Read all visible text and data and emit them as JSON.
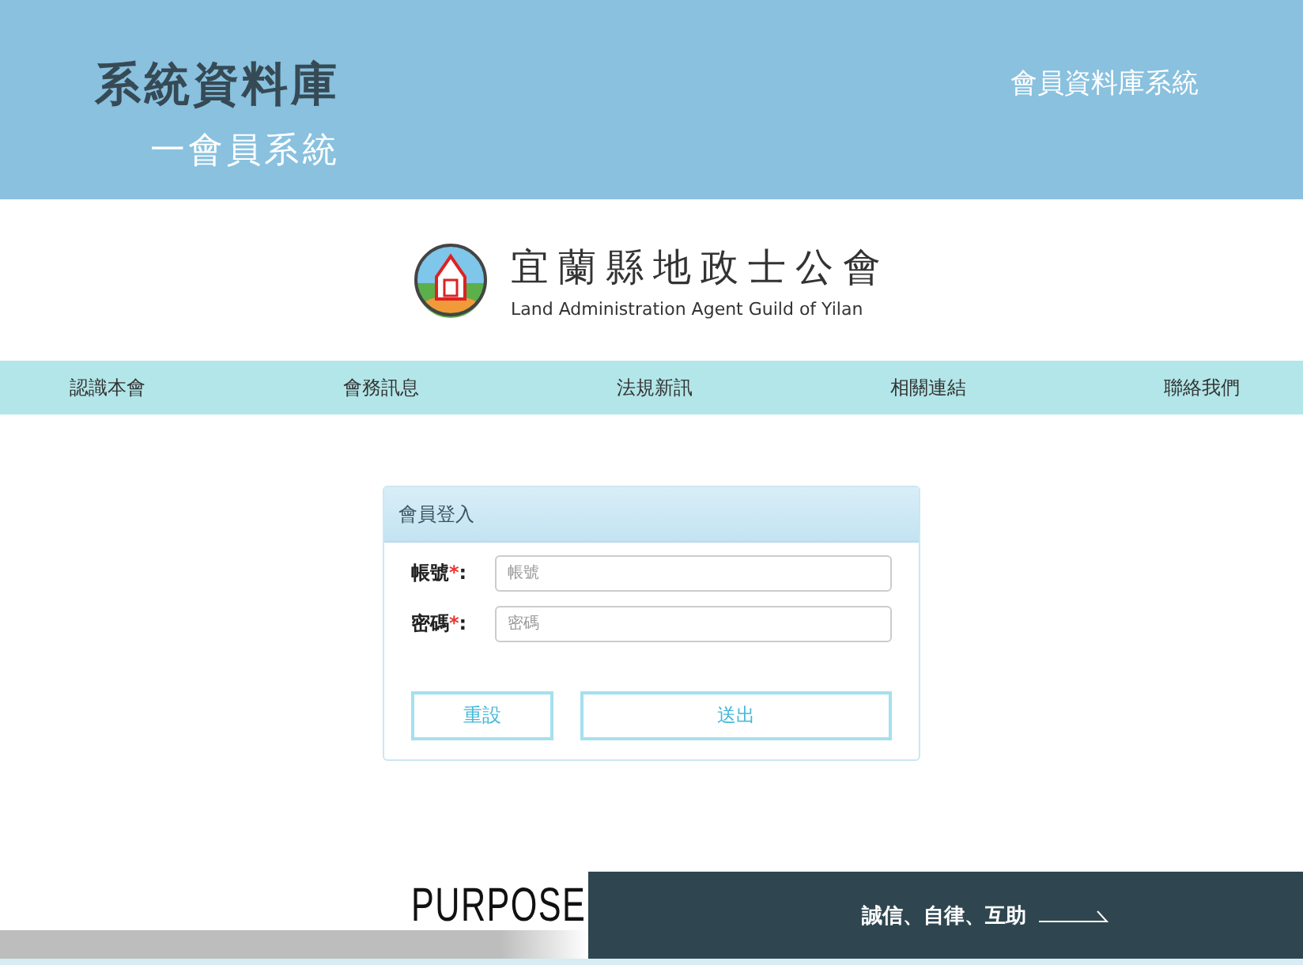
{
  "header": {
    "title": "系統資料庫",
    "subtitle": "一會員系統",
    "system_name": "會員資料庫系統"
  },
  "logo": {
    "name": "宜蘭縣地政士公會",
    "english": "Land Administration Agent Guild of Yilan"
  },
  "nav": [
    {
      "label": "認識本會"
    },
    {
      "label": "會務訊息"
    },
    {
      "label": "法規新訊"
    },
    {
      "label": "相關連結"
    },
    {
      "label": "聯絡我們"
    }
  ],
  "login": {
    "title": "會員登入",
    "fields": [
      {
        "label": "帳號",
        "required_mark": "*",
        "colon": ":",
        "placeholder": "帳號"
      },
      {
        "label": "密碼",
        "required_mark": "*",
        "colon": ":",
        "placeholder": "密碼"
      }
    ],
    "buttons": [
      {
        "label": "重設",
        "kind": "reset"
      },
      {
        "label": "送出",
        "kind": "submit"
      }
    ]
  },
  "banner": {
    "heading": "PURPOSE",
    "motto": "誠信、自律、互助"
  }
}
